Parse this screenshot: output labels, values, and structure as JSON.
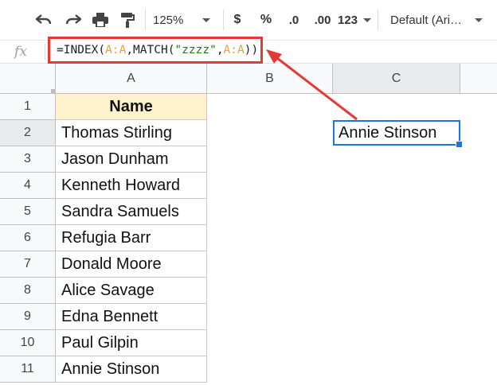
{
  "toolbar": {
    "zoom": "125%",
    "currency": "$",
    "percent": "%",
    "decrease_decimals": ".0",
    "increase_decimals": ".00",
    "more_formats": "123",
    "font": "Default (Ari…"
  },
  "formula_bar": {
    "fx_label": "fx",
    "formula_parts": [
      "=INDEX(",
      "A:A",
      ",MATCH(",
      "\"zzzz\"",
      ",",
      "A:A",
      "))"
    ]
  },
  "columns": [
    "A",
    "B",
    "C"
  ],
  "rows": [
    "1",
    "2",
    "3",
    "4",
    "5",
    "6",
    "7",
    "8",
    "9",
    "10",
    "11"
  ],
  "column_a": [
    "Name",
    "Thomas Stirling",
    "Jason Dunham",
    "Kenneth Howard",
    "Sandra Samuels",
    "Refugia Barr",
    "Donald Moore",
    "Alice Savage",
    "Edna Bennett",
    "Paul Gilpin",
    "Annie Stinson"
  ],
  "active_cell": {
    "ref": "C2",
    "value": "Annie Stinson"
  },
  "colors": {
    "header_fill": "#fff2cc",
    "annotation_red": "#e53935",
    "selection_blue": "#1a73e8",
    "range_color": "#e8a33d",
    "string_color": "#1a7a1a"
  }
}
